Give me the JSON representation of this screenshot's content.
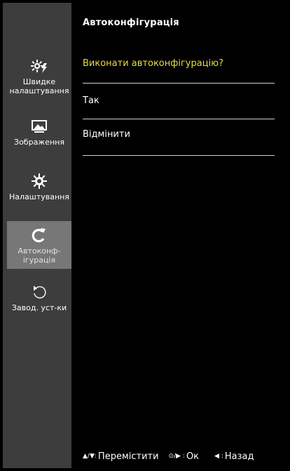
{
  "menu_title": "Автоконфігурація",
  "sidebar": {
    "items": [
      {
        "icon": "quick-settings-icon",
        "label": "Швидке\nналаштування",
        "active": false
      },
      {
        "icon": "picture-icon",
        "label": "Зображення",
        "active": false
      },
      {
        "icon": "gear-icon",
        "label": "Налаштування",
        "active": false
      },
      {
        "icon": "auto-config-icon",
        "label": "Автоконф-\nігурація",
        "active": true
      },
      {
        "icon": "reset-icon",
        "label": "Завод. уст-ки",
        "active": false
      }
    ]
  },
  "dialog": {
    "question": "Виконати автоконфігурацію?",
    "question_color": "#e6df3f",
    "options": [
      "Так",
      "Відмінити"
    ]
  },
  "footer": {
    "move_symbols": "▲/▼:",
    "move_label": "Перемістити",
    "ok_symbols": "⊙/▶ :",
    "ok_label": "Ок",
    "back_symbols": "◀ :",
    "back_label": "Назад"
  }
}
